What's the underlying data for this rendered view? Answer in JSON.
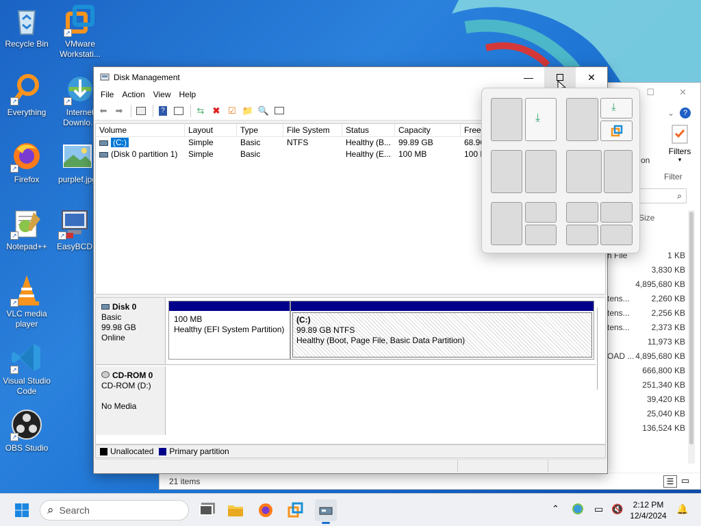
{
  "desktop": {
    "icons": [
      {
        "label": "Recycle Bin"
      },
      {
        "label": "VMware Workstati..."
      },
      {
        "label": "Everything"
      },
      {
        "label": "Internet Downlo..."
      },
      {
        "label": "Firefox"
      },
      {
        "label": "purplef.jpg"
      },
      {
        "label": "Notepad++"
      },
      {
        "label": "EasyBCD"
      },
      {
        "label": "VLC media player"
      },
      {
        "label": "Visual Studio Code"
      },
      {
        "label": "OBS Studio"
      }
    ]
  },
  "explorer_bg": {
    "filters_label": "Filters",
    "filter_group": "Filter",
    "size_header": "Size",
    "partial_on": "on",
    "partial_rows": [
      "h File",
      "",
      "",
      "tens...",
      "tens...",
      "tens...",
      "",
      "OAD ..."
    ],
    "sizes": [
      "1 KB",
      "3,830 KB",
      "4,895,680 KB",
      "2,260 KB",
      "2,256 KB",
      "2,373 KB",
      "11,973 KB",
      "4,895,680 KB",
      "666,800 KB",
      "251,340 KB",
      "39,420 KB",
      "25,040 KB",
      "136,524 KB"
    ],
    "status": "21 items"
  },
  "disk_mgmt": {
    "title": "Disk Management",
    "menu": [
      "File",
      "Action",
      "View",
      "Help"
    ],
    "columns": [
      "Volume",
      "Layout",
      "Type",
      "File System",
      "Status",
      "Capacity",
      "Free S"
    ],
    "rows": [
      {
        "volume": "(C:)",
        "layout": "Simple",
        "type": "Basic",
        "fs": "NTFS",
        "status": "Healthy (B...",
        "capacity": "99.89 GB",
        "free": "68.96"
      },
      {
        "volume": "(Disk 0 partition 1)",
        "layout": "Simple",
        "type": "Basic",
        "fs": "",
        "status": "Healthy (E...",
        "capacity": "100 MB",
        "free": "100 M"
      }
    ],
    "disks": [
      {
        "name": "Disk 0",
        "kind": "Basic",
        "size": "99.98 GB",
        "state": "Online"
      },
      {
        "name": "CD-ROM 0",
        "kind": "CD-ROM (D:)",
        "size": "",
        "state": "No Media"
      }
    ],
    "partitions": [
      {
        "name": "",
        "size": "100 MB",
        "status": "Healthy (EFI System Partition)"
      },
      {
        "name": "(C:)",
        "size": "99.89 GB NTFS",
        "status": "Healthy (Boot, Page File, Basic Data Partition)"
      }
    ],
    "legend": [
      {
        "label": "Unallocated",
        "color": "#000000"
      },
      {
        "label": "Primary partition",
        "color": "#00008b"
      }
    ]
  },
  "taskbar": {
    "search_placeholder": "Search",
    "time": "2:12 PM",
    "date": "12/4/2024"
  }
}
